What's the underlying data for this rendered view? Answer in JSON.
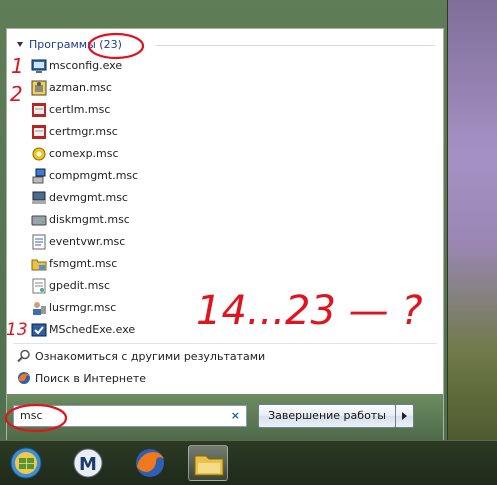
{
  "start_menu": {
    "group_label": "Программы",
    "group_count": "(23)",
    "programs": [
      {
        "label": "msconfig.exe",
        "icon": "msconfig-icon"
      },
      {
        "label": "azman.msc",
        "icon": "azman-icon"
      },
      {
        "label": "certlm.msc",
        "icon": "certificate-icon"
      },
      {
        "label": "certmgr.msc",
        "icon": "certificate-icon"
      },
      {
        "label": "comexp.msc",
        "icon": "component-services-icon"
      },
      {
        "label": "compmgmt.msc",
        "icon": "computer-management-icon"
      },
      {
        "label": "devmgmt.msc",
        "icon": "device-manager-icon"
      },
      {
        "label": "diskmgmt.msc",
        "icon": "disk-management-icon"
      },
      {
        "label": "eventvwr.msc",
        "icon": "event-viewer-icon"
      },
      {
        "label": "fsmgmt.msc",
        "icon": "shared-folders-icon"
      },
      {
        "label": "gpedit.msc",
        "icon": "group-policy-icon"
      },
      {
        "label": "lusrmgr.msc",
        "icon": "local-users-icon"
      },
      {
        "label": "MSchedExe.exe",
        "icon": "scheduler-icon"
      }
    ],
    "more_results_label": "Ознакомиться с другими результатами",
    "internet_search_label": "Поиск в Интернете",
    "search_value": "msc",
    "shutdown_label": "Завершение работы"
  },
  "annotations": {
    "num1": "1",
    "num2": "2",
    "num13": "13",
    "range_note": "14...23 — ?"
  },
  "taskbar": {
    "items": [
      "start-orb-icon",
      "app-m-icon",
      "firefox-icon",
      "explorer-icon"
    ]
  },
  "colors": {
    "annotation_red": "#e0141e",
    "link_blue": "#1f3d8a"
  }
}
